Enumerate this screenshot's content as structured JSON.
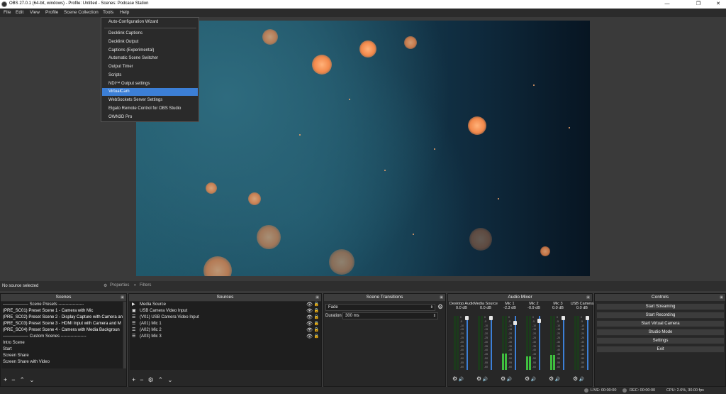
{
  "window": {
    "title": "OBS 27.0.1 (64-bit, windows) - Profile: Untitled - Scenes: Podcase Station"
  },
  "menu": [
    "File",
    "Edit",
    "View",
    "Profile",
    "Scene Collection",
    "Tools",
    "Help"
  ],
  "tools_menu": {
    "items": [
      "Auto-Configuration Wizard",
      "Decklink Captions",
      "Decklink Output",
      "Captions (Experimental)",
      "Automatic Scene Switcher",
      "Output Timer",
      "Scripts",
      "NDI™ Output settings",
      "VirtualCam",
      "WebSockets Server Settings",
      "Elgato Remote Control for OBS Studio",
      "OWN3D Pro"
    ],
    "active": "VirtualCam"
  },
  "source_bar": {
    "no_source": "No source selected",
    "properties": "Properties",
    "filters": "Filters"
  },
  "scenes": {
    "title": "Scenes",
    "items": [
      "------------------ Scene Presets ------------------",
      "(PRE_SC01) Preset Scene 1 - Camera with Mic",
      "(PRE_SC02) Preset Scene 2 - Display Capture with Camera an",
      "(PRE_SC03) Preset Scene 3 - HDMI Input with Camera and M",
      "(PRE_SC04) Preset Scene 4 - Camera with Media Backgroun",
      "------------------ Custom Scenes ------------------",
      "Intro Scene",
      "Start",
      "Screen Share",
      "Screen Share with Video"
    ]
  },
  "sources": {
    "title": "Sources",
    "items": [
      "Media Source",
      "USB Camera Video Input",
      "(V01) USB Camera Video Input",
      "(A01) Mic 1",
      "(A02) Mic 2",
      "(A03) Mic 3"
    ]
  },
  "transitions": {
    "title": "Scene Transitions",
    "selected": "Fade",
    "duration_label": "Duration",
    "duration_value": "300 ms"
  },
  "mixer": {
    "title": "Audio Mixer",
    "scale": [
      "0",
      "-5",
      "-10",
      "-15",
      "-20",
      "-25",
      "-30",
      "-35",
      "-40",
      "-45",
      "-50",
      "-55",
      "-60"
    ],
    "channels": [
      {
        "name": "Desktop Audio",
        "db": "0.0 dB",
        "level": 0.0,
        "fader": 1.0
      },
      {
        "name": "Media Source",
        "db": "0.0 dB",
        "level": 0.0,
        "fader": 1.0
      },
      {
        "name": "Mic 1",
        "db": "-2.3 dB",
        "level": 0.3,
        "fader": 0.9
      },
      {
        "name": "Mic 2",
        "db": "-0.9 dB",
        "level": 0.25,
        "fader": 0.95
      },
      {
        "name": "Mic 3",
        "db": "0.0 dB",
        "level": 0.28,
        "fader": 1.0
      },
      {
        "name": "USB Camera",
        "db": "0.0 dB",
        "level": 0.0,
        "fader": 1.0
      }
    ]
  },
  "controls": {
    "title": "Controls",
    "buttons": [
      "Start Streaming",
      "Start Recording",
      "Start Virtual Camera",
      "Studio Mode",
      "Settings",
      "Exit"
    ]
  },
  "status": {
    "live": "LIVE: 00:00:00",
    "rec": "REC: 00:00:00",
    "cpu": "CPU: 2.6%, 30.00 fps"
  }
}
